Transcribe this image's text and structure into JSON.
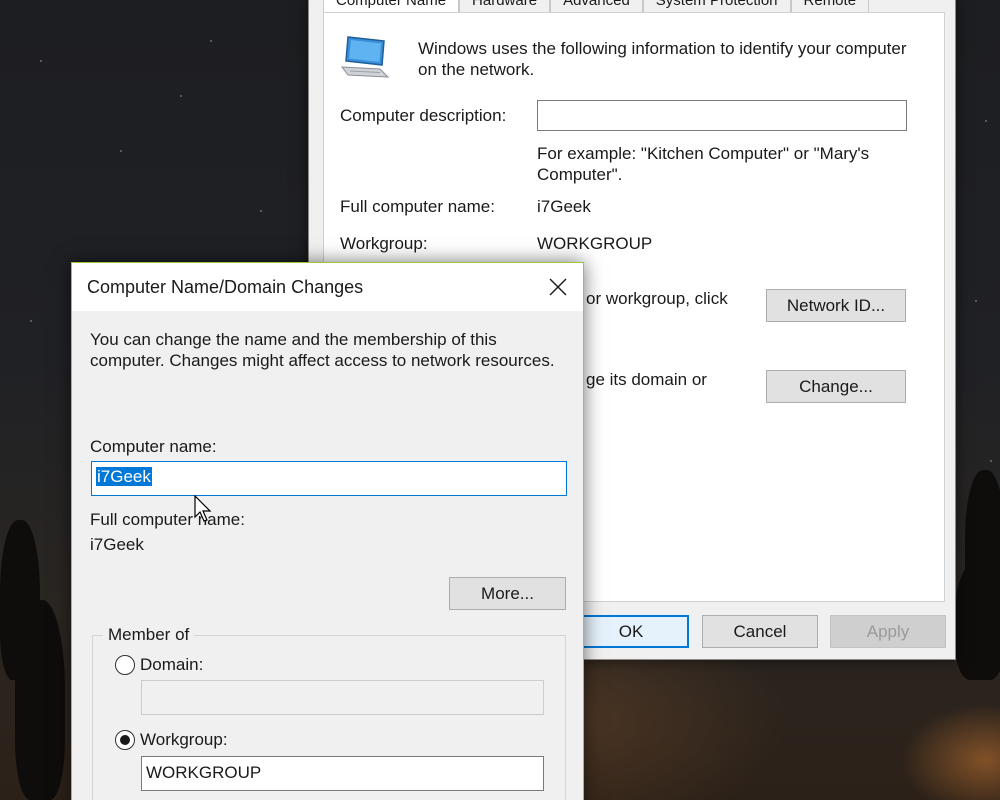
{
  "system_properties": {
    "tabs": [
      "Computer Name",
      "Hardware",
      "Advanced",
      "System Protection",
      "Remote"
    ],
    "intro_text_line1": "Windows uses the following information to identify your computer",
    "intro_text_line2": "on the network.",
    "description_label": "Computer description:",
    "description_value": "",
    "example_line1": "For example: \"Kitchen Computer\" or \"Mary's",
    "example_line2": "Computer\".",
    "full_name_label": "Full computer name:",
    "full_name_value": "i7Geek",
    "workgroup_label": "Workgroup:",
    "workgroup_value": "WORKGROUP",
    "network_id_partial": "or workgroup, click",
    "change_partial": "ge its domain or",
    "network_id_button": "Network ID...",
    "change_button": "Change...",
    "ok_button": "OK",
    "cancel_button": "Cancel",
    "apply_button": "Apply"
  },
  "dialog": {
    "title": "Computer Name/Domain Changes",
    "intro_line1": "You can change the name and the membership of this",
    "intro_line2": "computer. Changes might affect access to network resources.",
    "computer_name_label": "Computer name:",
    "computer_name_value": "i7Geek",
    "full_name_label": "Full computer name:",
    "full_name_value": "i7Geek",
    "more_button": "More...",
    "member_of_label": "Member of",
    "domain_label": "Domain:",
    "domain_value": "",
    "workgroup_label": "Workgroup:",
    "workgroup_value": "WORKGROUP",
    "selected_option": "workgroup"
  },
  "icons": {
    "computer": "computer-icon",
    "close": "close-icon",
    "cursor": "mouse-cursor-icon"
  },
  "colors": {
    "accent": "#0078d7",
    "dialog_border": "#9bc53d"
  }
}
